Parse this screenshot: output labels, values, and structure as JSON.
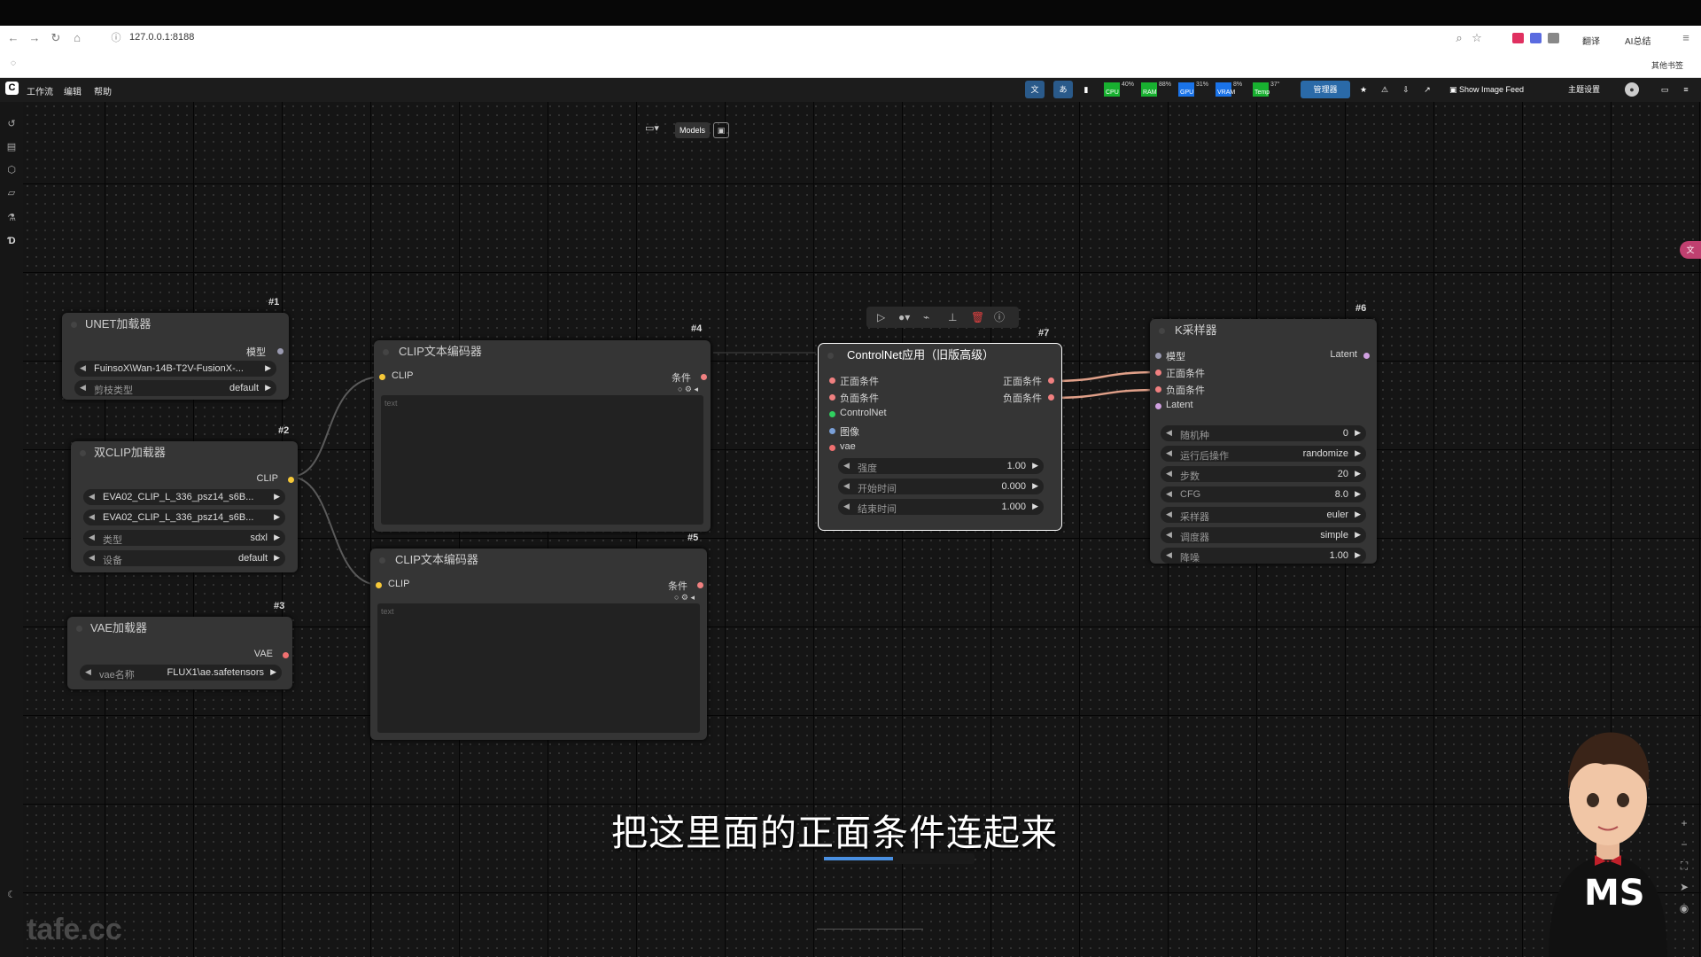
{
  "browser": {
    "url": "127.0.0.1:8188",
    "translate_label": "翻译",
    "ai_label": "AI总结",
    "bookmarks_label": "其他书签"
  },
  "app": {
    "menu": [
      "工作流",
      "编辑",
      "帮助"
    ],
    "toolbar": {
      "meters": [
        {
          "name": "CPU",
          "value": "40%",
          "color": "#18b030"
        },
        {
          "name": "RAM",
          "value": "88%",
          "color": "#18b030"
        },
        {
          "name": "GPU",
          "value": "31%",
          "color": "#1a73e8"
        },
        {
          "name": "VRAM",
          "value": "8%",
          "color": "#1a73e8"
        },
        {
          "name": "Temp",
          "value": "37°",
          "color": "#18b030"
        }
      ],
      "manager_label": "管理器",
      "image_feed_label": "Show Image Feed",
      "theme_label": "主题设置"
    },
    "canvas_menu": {
      "models_label": "Models"
    }
  },
  "nodes": {
    "unet": {
      "id": "#1",
      "title": "UNET加载器",
      "output": "模型",
      "model": "FuinsoX\\Wan-14B-T2V-FusionX-...",
      "prune_label": "剪枝类型",
      "prune_value": "default"
    },
    "dualclip": {
      "id": "#2",
      "title": "双CLIP加载器",
      "output": "CLIP",
      "clip1": "EVA02_CLIP_L_336_psz14_s6B...",
      "clip2": "EVA02_CLIP_L_336_psz14_s6B...",
      "type_label": "类型",
      "type_value": "sdxl",
      "device_label": "设备",
      "device_value": "default"
    },
    "vae": {
      "id": "#3",
      "title": "VAE加载器",
      "output": "VAE",
      "name_label": "vae名称",
      "name_value": "FLUX1\\ae.safetensors"
    },
    "clip_top": {
      "id": "#4",
      "title": "CLIP文本编码器",
      "input": "CLIP",
      "output": "条件",
      "placeholder": "text"
    },
    "clip_bottom": {
      "id": "#5",
      "title": "CLIP文本编码器",
      "input": "CLIP",
      "output": "条件",
      "placeholder": "text"
    },
    "ksampler": {
      "id": "#6",
      "title": "K采样器",
      "inputs": [
        "模型",
        "正面条件",
        "负面条件",
        "Latent"
      ],
      "output": "Latent",
      "widgets": [
        {
          "label": "随机种",
          "value": "0"
        },
        {
          "label": "运行后操作",
          "value": "randomize"
        },
        {
          "label": "步数",
          "value": "20"
        },
        {
          "label": "CFG",
          "value": "8.0"
        },
        {
          "label": "采样器",
          "value": "euler"
        },
        {
          "label": "调度器",
          "value": "simple"
        },
        {
          "label": "降噪",
          "value": "1.00"
        }
      ]
    },
    "controlnet": {
      "id": "#7",
      "title": "ControlNet应用（旧版高级）",
      "inputs": [
        "正面条件",
        "负面条件",
        "ControlNet",
        "图像",
        "vae"
      ],
      "outputs": [
        "正面条件",
        "负面条件"
      ],
      "widgets": [
        {
          "label": "强度",
          "value": "1.00"
        },
        {
          "label": "开始时间",
          "value": "0.000"
        },
        {
          "label": "结束时间",
          "value": "1.000"
        }
      ]
    }
  },
  "subtitle": "把这里面的正面条件连起来",
  "watermark": "tafe.cc",
  "avatar_shirt": "MS",
  "colors": {
    "canvas": "#151515",
    "node": "#353535",
    "link": "#e0a089",
    "clip_dot": "#f6c838",
    "cond_dot": "#f08080",
    "controlnet_dot": "#30d060",
    "image_dot": "#7aa0d8"
  }
}
